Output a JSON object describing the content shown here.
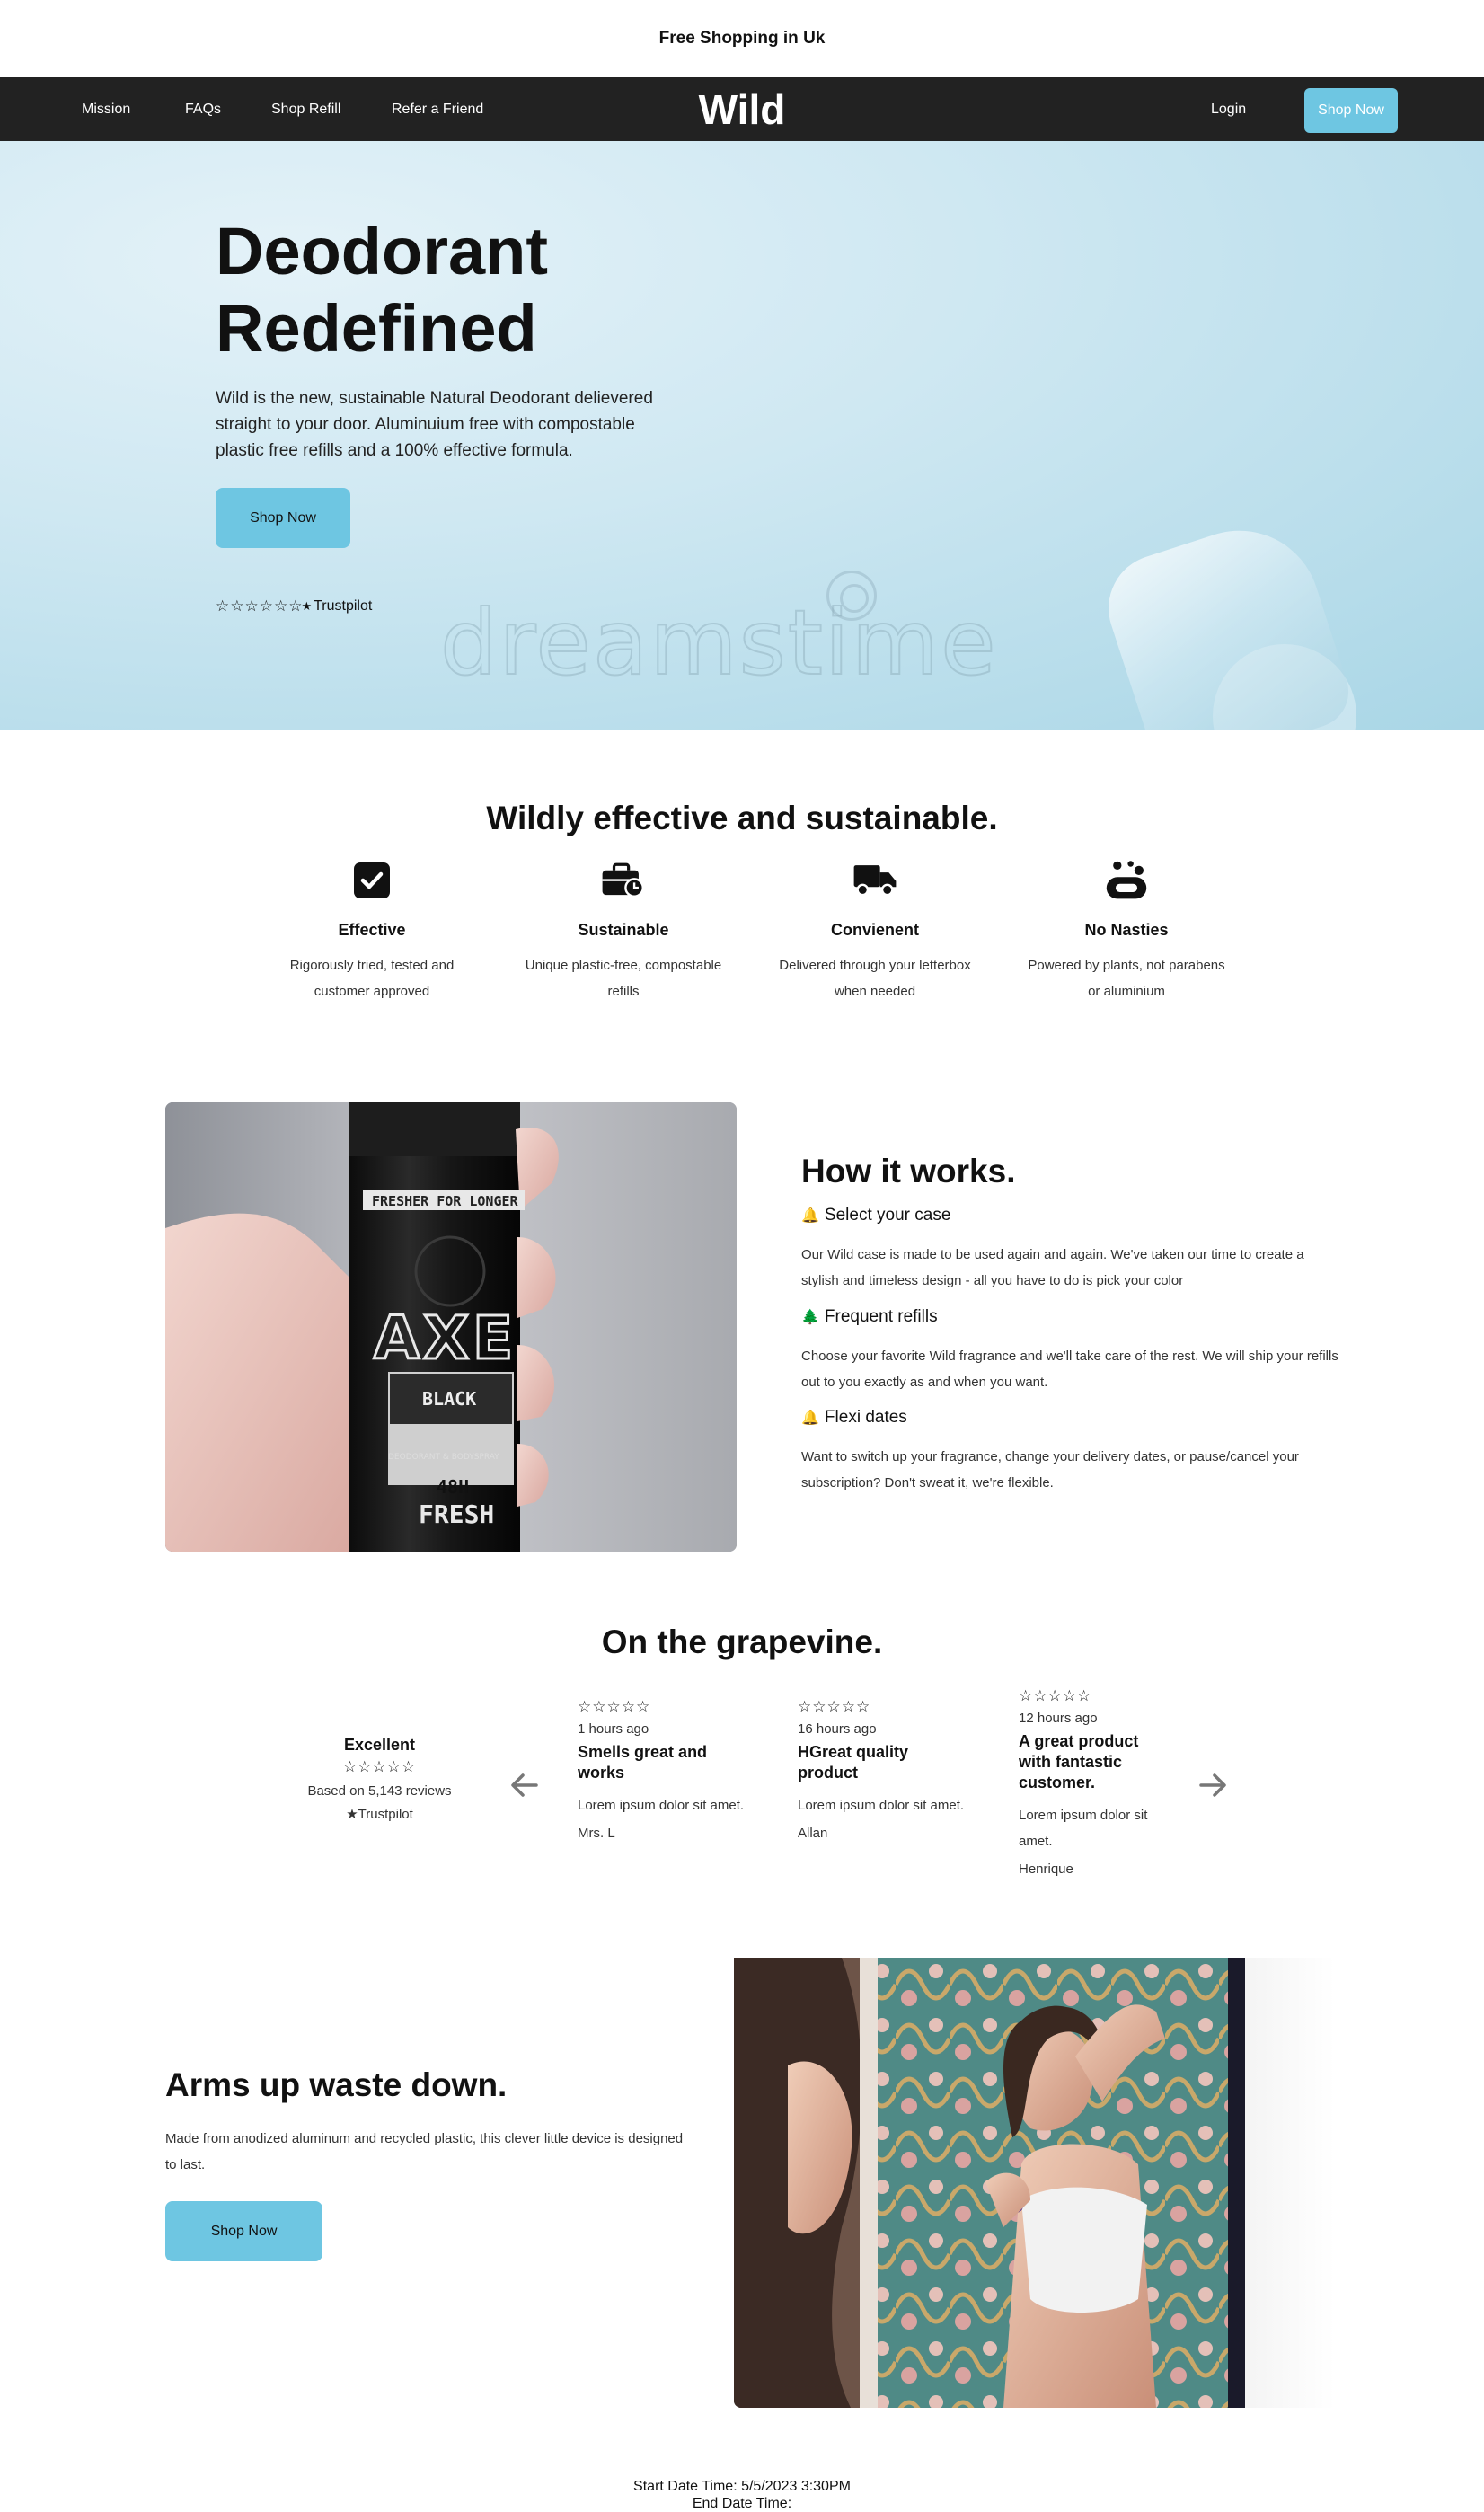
{
  "promo": {
    "text": "Free Shopping in Uk"
  },
  "nav": {
    "links": [
      "Mission",
      "FAQs",
      "Shop Refill",
      "Refer a Friend"
    ],
    "logo": "Wild",
    "login": "Login",
    "shop_now": "Shop Now"
  },
  "hero": {
    "title_line1": "Deodorant",
    "title_line2": "Redefined",
    "description": "Wild is the new, sustainable Natural Deodorant delievered straight to your door. Aluminuium free with compostable plastic free refills and a 100% effective formula.",
    "button": "Shop Now",
    "rating_stars": "☆☆☆☆☆☆",
    "trustpilot": "Trustpilot",
    "watermark": "dreamstime"
  },
  "features": {
    "title": "Wildly effective and sustainable.",
    "items": [
      {
        "icon": "checkbox-icon",
        "title": "Effective",
        "desc": "Rigorously tried, tested and customer approved"
      },
      {
        "icon": "briefcase-clock-icon",
        "title": "Sustainable",
        "desc": "Unique plastic-free, compostable refills"
      },
      {
        "icon": "truck-icon",
        "title": "Convienent",
        "desc": "Delivered through your letterbox when needed"
      },
      {
        "icon": "soap-icon",
        "title": "No Nasties",
        "desc": "Powered by plants, not parabens or aluminium"
      }
    ]
  },
  "how": {
    "title": "How it works.",
    "image_label_top": "FRESHER FOR LONGER",
    "image_brand": "AXE",
    "image_variant": "BLACK",
    "image_sub": "DEODORANT & BODYSPRAY",
    "image_hours": "48H",
    "image_fresh": "FRESH",
    "steps": [
      {
        "title": "Select your case",
        "desc": "Our Wild case is made to be used again and again. We've taken our time to create a stylish and timeless design - all you have to do is pick your color"
      },
      {
        "title": "Frequent refills",
        "desc": "Choose your favorite Wild fragrance and we'll take care of the rest. We will ship your refills out to you exactly as and when you want."
      },
      {
        "title": "Flexi dates",
        "desc": "Want to switch up your fragrance, change your delivery dates, or pause/cancel your subscription? Don't sweat it, we're flexible."
      }
    ]
  },
  "grapevine": {
    "title": "On the grapevine.",
    "summary": {
      "title": "Excellent",
      "stars": "☆☆☆☆☆",
      "reviews": "Based on 5,143 reviews",
      "trustpilot": "Trustpilot"
    },
    "reviews": [
      {
        "stars": "☆☆☆☆☆",
        "ago": "1 hours ago",
        "title": "Smells great and works",
        "body": "Lorem ipsum dolor sit amet.",
        "author": "Mrs. L"
      },
      {
        "stars": "☆☆☆☆☆",
        "ago": "16 hours ago",
        "title": "HGreat quality product",
        "body": "Lorem ipsum dolor sit amet.",
        "author": "Allan"
      },
      {
        "stars": "☆☆☆☆☆",
        "ago": "12 hours ago",
        "title": "A great product with fantastic customer.",
        "body": "Lorem ipsum dolor sit amet.",
        "author": "Henrique"
      }
    ]
  },
  "arms": {
    "title": "Arms up waste down.",
    "description": "Made from anodized aluminum and recycled plastic, this clever little device is designed to last.",
    "button": "Shop Now"
  },
  "footer": {
    "start": "Start Date Time: 5/5/2023 3:30PM",
    "end": "End Date Time:"
  },
  "colors": {
    "accent": "#6ec6e2",
    "nav_bg": "#222222"
  }
}
